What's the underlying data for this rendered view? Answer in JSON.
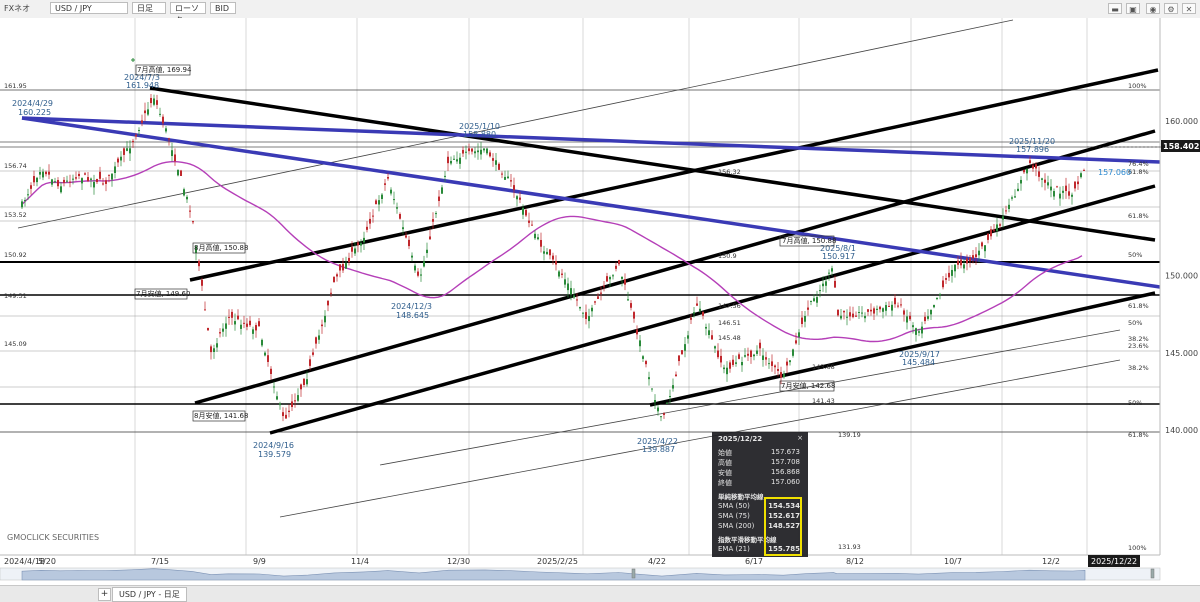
{
  "toolbar": {
    "brand": "FXネオ",
    "symbol": "USD / JPY",
    "timeframe": "日足",
    "chart_style": "ローソク",
    "price_side": "BID",
    "icons": [
      "minimize-icon",
      "restore-icon",
      "camera-icon",
      "settings-icon",
      "close-icon"
    ]
  },
  "tab": {
    "label": "USD / JPY - 日足",
    "add": "+"
  },
  "watermark": "GMOCLICK SECURITIES",
  "popup": {
    "date": "2025/12/22",
    "close_symbol": "×",
    "ohlc": [
      {
        "label": "始値",
        "value": "157.673"
      },
      {
        "label": "高値",
        "value": "157.708"
      },
      {
        "label": "安値",
        "value": "156.868"
      },
      {
        "label": "終値",
        "value": "157.060"
      }
    ],
    "sma_title": "単純移動平均線",
    "sma": [
      {
        "label": "SMA (50)",
        "value": "154.534"
      },
      {
        "label": "SMA (75)",
        "value": "152.617"
      },
      {
        "label": "SMA (200)",
        "value": "148.527"
      }
    ],
    "ema_title": "指数平滑移動平均線",
    "ema": [
      {
        "label": "EMA (21)",
        "value": "155.785"
      }
    ]
  },
  "chart_data": {
    "type": "line",
    "symbol": "USD / JPY",
    "ylim": [
      137.2,
      163.6
    ],
    "x_tick_labels": [
      "2024/4/18",
      "5/20",
      "7/15",
      "9/9",
      "11/4",
      "12/30",
      "2025/2/25",
      "4/22",
      "6/17",
      "8/12",
      "10/7",
      "12/2",
      "2025/12/22"
    ],
    "y_tick_labels": [
      160.0,
      150.0,
      145.0,
      140.0
    ],
    "current_price": "158.402",
    "close_path": [
      [
        "2024/4/18",
        154.6
      ],
      [
        "2024/4/29",
        157.0
      ],
      [
        "2024/5/10",
        155.8
      ],
      [
        "2024/5/20",
        156.5
      ],
      [
        "2024/6/5",
        156.0
      ],
      [
        "2024/6/20",
        158.5
      ],
      [
        "2024/7/3",
        161.6
      ],
      [
        "2024/7/12",
        158.8
      ],
      [
        "2024/7/25",
        153.9
      ],
      [
        "2024/8/5",
        145.0
      ],
      [
        "2024/8/15",
        147.3
      ],
      [
        "2024/9/2",
        146.5
      ],
      [
        "2024/9/16",
        140.6
      ],
      [
        "2024/9/30",
        143.6
      ],
      [
        "2024/10/15",
        149.6
      ],
      [
        "2024/11/1",
        152.5
      ],
      [
        "2024/11/15",
        156.3
      ],
      [
        "2024/12/3",
        149.6
      ],
      [
        "2024/12/20",
        157.5
      ],
      [
        "2025/1/10",
        158.2
      ],
      [
        "2025/1/25",
        156.0
      ],
      [
        "2025/2/10",
        152.2
      ],
      [
        "2025/2/25",
        149.8
      ],
      [
        "2025/3/10",
        147.2
      ],
      [
        "2025/3/28",
        150.8
      ],
      [
        "2025/4/10",
        145.4
      ],
      [
        "2025/4/22",
        140.5
      ],
      [
        "2025/5/12",
        148.2
      ],
      [
        "2025/5/28",
        143.9
      ],
      [
        "2025/6/17",
        145.2
      ],
      [
        "2025/7/1",
        143.3
      ],
      [
        "2025/7/15",
        147.8
      ],
      [
        "2025/7/30",
        150.5
      ],
      [
        "2025/8/1",
        147.4
      ],
      [
        "2025/8/20",
        147.6
      ],
      [
        "2025/9/5",
        148.2
      ],
      [
        "2025/9/17",
        146.4
      ],
      [
        "2025/10/7",
        150.5
      ],
      [
        "2025/10/20",
        151.2
      ],
      [
        "2025/11/5",
        153.7
      ],
      [
        "2025/11/20",
        157.3
      ],
      [
        "2025/12/2",
        155.7
      ],
      [
        "2025/12/15",
        155.2
      ],
      [
        "2025/12/22",
        157.06
      ]
    ],
    "series": [
      {
        "name": "SMA (50)",
        "value": 154.534,
        "color": "#d08a1e"
      },
      {
        "name": "SMA (75)",
        "value": 152.617,
        "color": "#3a92d0"
      },
      {
        "name": "SMA (200)",
        "value": 148.527,
        "color": "#b53fb8"
      },
      {
        "name": "EMA (21)",
        "value": 155.785,
        "color": "#d22c2c"
      }
    ],
    "annotations": [
      {
        "text": "2024/4/29"
      },
      {
        "text": "160.225"
      },
      {
        "text": "7月高値, 169.94"
      },
      {
        "text": "2024/7/3"
      },
      {
        "text": "161.948"
      },
      {
        "text": "2025/1/10"
      },
      {
        "text": "158.880"
      },
      {
        "text": "8月高値, 150.88"
      },
      {
        "text": "7月安値, 149.60"
      },
      {
        "text": "8月安値, 141.68"
      },
      {
        "text": "2024/9/16"
      },
      {
        "text": "139.579"
      },
      {
        "text": "2024/12/3"
      },
      {
        "text": "148.645"
      },
      {
        "text": "2025/4/22"
      },
      {
        "text": "139.887"
      },
      {
        "text": "7月高値, 150.88"
      },
      {
        "text": "2025/8/1"
      },
      {
        "text": "150.917"
      },
      {
        "text": "7月安値, 142.68"
      },
      {
        "text": "2025/9/17"
      },
      {
        "text": "145.484"
      },
      {
        "text": "2025/11/20"
      },
      {
        "text": "157.896"
      },
      {
        "text": "157.060"
      }
    ],
    "level_labels": [
      "161.95",
      "156.74",
      "153.52",
      "150.92",
      "149.31",
      "145.09",
      "156.32",
      "150.9",
      "147.56",
      "146.51",
      "145.48",
      "143.68",
      "141.43",
      "139.19",
      "131.93"
    ],
    "fib_labels": [
      "100%",
      "76.4%",
      "61.8%",
      "61.8%",
      "50%",
      "61.8%",
      "50%",
      "38.2%",
      "23.6%",
      "38.2%",
      "50%",
      "61.8%",
      "100%"
    ]
  }
}
